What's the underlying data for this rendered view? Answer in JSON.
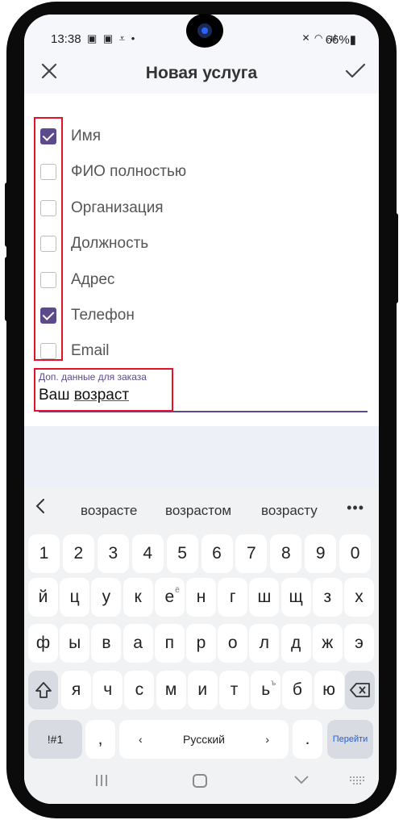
{
  "status_bar": {
    "time": "13:38",
    "left_icons": "▣ ▣ ⩡ •",
    "right_icons": "✕ ◠ .ıl",
    "battery": "66%▮"
  },
  "app_bar": {
    "title": "Новая услуга",
    "close_icon": "close-icon",
    "confirm_icon": "check-icon"
  },
  "fields": [
    {
      "label": "Имя",
      "checked": true
    },
    {
      "label": "ФИО полностью",
      "checked": false
    },
    {
      "label": "Организация",
      "checked": false
    },
    {
      "label": "Должность",
      "checked": false
    },
    {
      "label": "Адрес",
      "checked": false
    },
    {
      "label": "Телефон",
      "checked": true
    },
    {
      "label": "Email",
      "checked": false
    }
  ],
  "extra_field": {
    "label": "Доп. данные для заказа",
    "value_prefix": "Ваш ",
    "value_word": "возраст"
  },
  "keyboard": {
    "suggestions": [
      "возрасте",
      "возрастом",
      "возрасту"
    ],
    "more": "•••",
    "row_numbers": [
      "1",
      "2",
      "3",
      "4",
      "5",
      "6",
      "7",
      "8",
      "9",
      "0"
    ],
    "row1": [
      "й",
      "ц",
      "у",
      "к",
      "е",
      "н",
      "г",
      "ш",
      "щ",
      "з",
      "х"
    ],
    "row1_alt": "ё",
    "row2": [
      "ф",
      "ы",
      "в",
      "а",
      "п",
      "р",
      "о",
      "л",
      "д",
      "ж",
      "э"
    ],
    "row3": [
      "я",
      "ч",
      "с",
      "м",
      "и",
      "т",
      "ь",
      "б",
      "ю"
    ],
    "row3_alt": "ъ",
    "symbols_key": "!#1",
    "comma_key": ",",
    "space_label": "Русский",
    "left_arrow": "‹",
    "right_arrow": "›",
    "period_key": ".",
    "go_key": "Перейти"
  },
  "colors": {
    "accent": "#5c4a8c",
    "highlight": "#e5132a",
    "go_text": "#1e5fe0"
  }
}
